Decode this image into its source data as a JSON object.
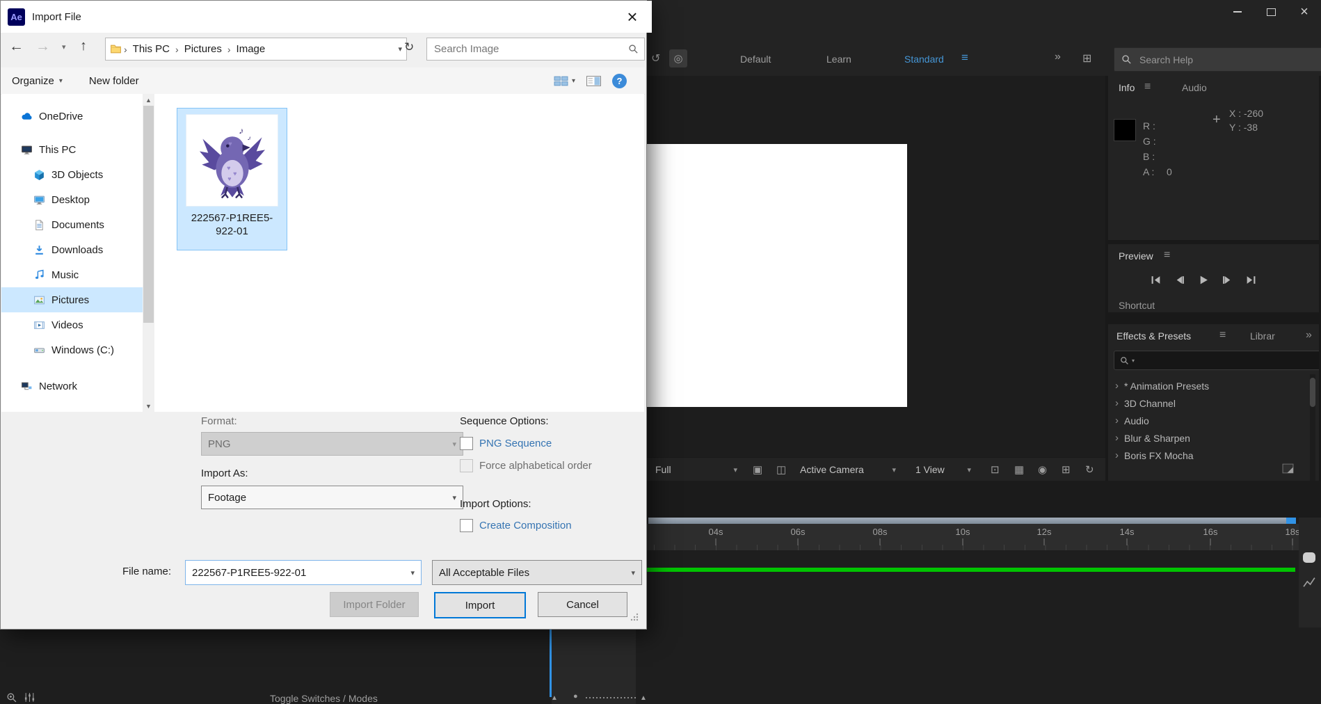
{
  "dialog": {
    "logo": "Ae",
    "title": "Import File",
    "nav": {
      "breadcrumb": [
        "This PC",
        "Pictures",
        "Image"
      ],
      "search_placeholder": "Search Image"
    },
    "toolbar": {
      "organize": "Organize",
      "new_folder": "New folder"
    },
    "sidebar": {
      "items": [
        {
          "label": "OneDrive"
        },
        {
          "label": "This PC"
        },
        {
          "label": "3D Objects"
        },
        {
          "label": "Desktop"
        },
        {
          "label": "Documents"
        },
        {
          "label": "Downloads"
        },
        {
          "label": "Music"
        },
        {
          "label": "Pictures"
        },
        {
          "label": "Videos"
        },
        {
          "label": "Windows (C:)"
        },
        {
          "label": "Network"
        }
      ],
      "selected": "Pictures"
    },
    "file": {
      "name": "222567-P1REE5-922-01"
    },
    "form": {
      "format_label": "Format:",
      "format_value": "PNG",
      "sequence_options_label": "Sequence Options:",
      "png_sequence_label": "PNG Sequence",
      "force_alpha_label": "Force alphabetical order",
      "import_as_label": "Import As:",
      "import_as_value": "Footage",
      "import_options_label": "Import Options:",
      "create_comp_label": "Create Composition",
      "file_name_label": "File name:",
      "file_name_value": "222567-P1REE5-922-01",
      "file_type_value": "All Acceptable Files",
      "import_folder_button": "Import Folder",
      "import_button": "Import",
      "cancel_button": "Cancel"
    }
  },
  "ae": {
    "topbar": {
      "tabs": [
        "Default",
        "Learn",
        "Standard"
      ],
      "active_tab": "Standard",
      "search_placeholder": "Search Help"
    },
    "info_panel": {
      "tab": "Info",
      "tab2": "Audio",
      "channels": [
        "R :",
        "G :",
        "B :",
        "A :"
      ],
      "alpha_value": "0",
      "x_value": "X : -260",
      "y_value": "Y : -38"
    },
    "preview_panel": {
      "title": "Preview",
      "shortcut_label": "Shortcut"
    },
    "effects_panel": {
      "tab": "Effects & Presets",
      "tab2": "Librar",
      "overflow": "»",
      "items": [
        "* Animation Presets",
        "3D Channel",
        "Audio",
        "Blur & Sharpen",
        "Boris FX Mocha"
      ]
    },
    "viewer_bar": {
      "magnification": "Full",
      "camera": "Active Camera",
      "view_layout": "1 View"
    },
    "timeline": {
      "ticks": [
        "04s",
        "06s",
        "08s",
        "10s",
        "12s",
        "14s",
        "16s",
        "18s"
      ]
    },
    "bottom_bar": {
      "toggle_label": "Toggle Switches / Modes"
    }
  },
  "colors": {
    "windows_accent": "#0078d7",
    "selection_fill": "#cce8ff",
    "selection_border": "#84c3f5",
    "ae_workspace_active": "#4596d6",
    "timeline_green": "#00c300",
    "cti_blue": "#3193e6",
    "link_text": "#3574b2"
  }
}
